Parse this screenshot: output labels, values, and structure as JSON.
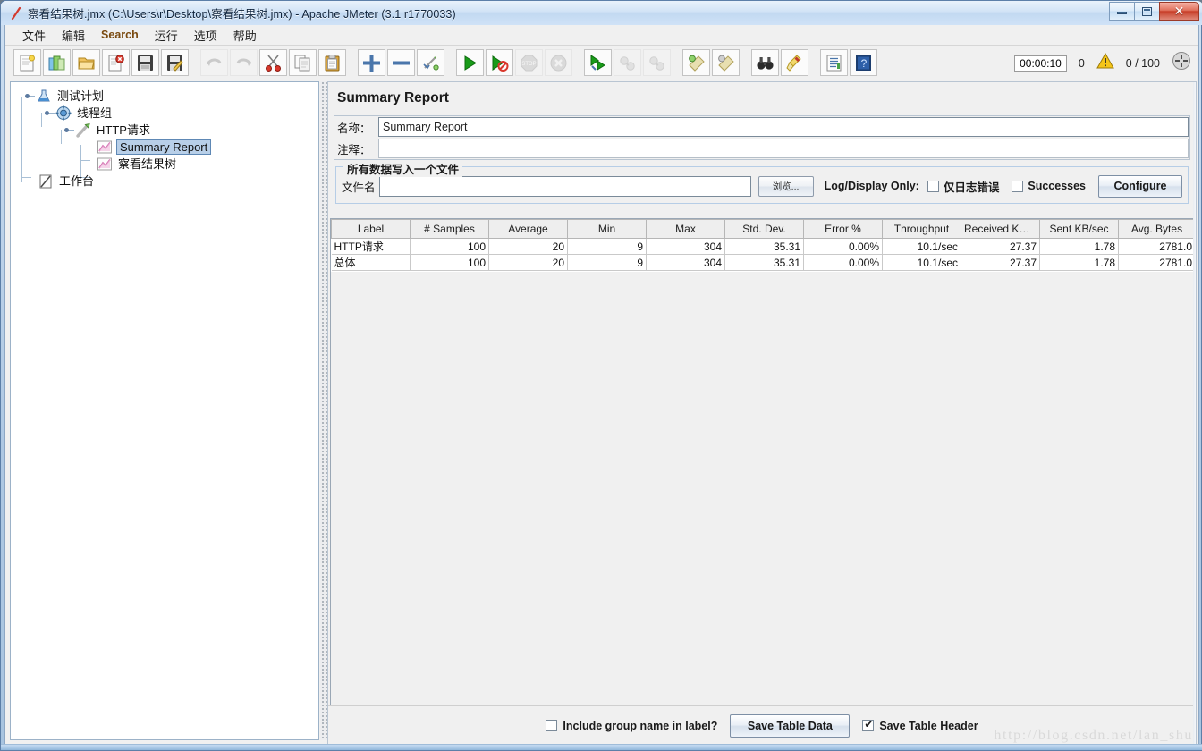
{
  "window": {
    "title": "察看结果树.jmx (C:\\Users\\r\\Desktop\\察看结果树.jmx) - Apache JMeter (3.1 r1770033)",
    "icon": "jmeter-feather-icon",
    "buttons": {
      "minimize": "–",
      "maximize": "□",
      "close": "✕"
    }
  },
  "menubar": {
    "items": [
      {
        "label": "文件",
        "lang": "zh"
      },
      {
        "label": "编辑",
        "lang": "zh"
      },
      {
        "label": "Search",
        "lang": "en"
      },
      {
        "label": "运行",
        "lang": "zh"
      },
      {
        "label": "选项",
        "lang": "zh"
      },
      {
        "label": "帮助",
        "lang": "zh"
      }
    ]
  },
  "toolbar": {
    "groups": [
      {
        "buttons": [
          {
            "icon": "new-document-icon",
            "disabled": false
          },
          {
            "icon": "templates-icon",
            "disabled": false
          },
          {
            "icon": "open-folder-icon",
            "disabled": false
          },
          {
            "icon": "close-document-icon",
            "disabled": false
          },
          {
            "icon": "save-floppy-icon",
            "disabled": false
          },
          {
            "icon": "save-as-icon",
            "disabled": false
          }
        ]
      },
      {
        "buttons": [
          {
            "icon": "undo-arrow-icon",
            "disabled": true
          },
          {
            "icon": "redo-arrow-icon",
            "disabled": true
          },
          {
            "icon": "cut-scissors-icon",
            "disabled": false
          },
          {
            "icon": "copy-pages-icon",
            "disabled": false
          },
          {
            "icon": "paste-clipboard-icon",
            "disabled": false
          }
        ]
      },
      {
        "buttons": [
          {
            "icon": "expand-plus-icon",
            "disabled": false
          },
          {
            "icon": "collapse-minus-icon",
            "disabled": false
          },
          {
            "icon": "toggle-enabled-icon",
            "disabled": false
          }
        ]
      },
      {
        "buttons": [
          {
            "icon": "start-play-icon",
            "disabled": false
          },
          {
            "icon": "start-no-timers-icon",
            "disabled": false
          },
          {
            "icon": "stop-sign-icon",
            "disabled": true
          },
          {
            "icon": "shutdown-x-icon",
            "disabled": true
          }
        ]
      },
      {
        "buttons": [
          {
            "icon": "remote-start-all-icon",
            "disabled": false
          },
          {
            "icon": "remote-stop-all-icon",
            "disabled": true
          },
          {
            "icon": "remote-shutdown-all-icon",
            "disabled": true
          }
        ]
      },
      {
        "buttons": [
          {
            "icon": "clear-broom-icon",
            "disabled": false
          },
          {
            "icon": "clear-all-broom-icon",
            "disabled": false
          }
        ]
      },
      {
        "buttons": [
          {
            "icon": "search-binoculars-icon",
            "disabled": false
          },
          {
            "icon": "reset-search-brush-icon",
            "disabled": false
          }
        ]
      },
      {
        "buttons": [
          {
            "icon": "function-helper-icon",
            "disabled": false
          },
          {
            "icon": "help-book-icon",
            "disabled": false
          }
        ]
      }
    ],
    "status": {
      "elapsed_time": "00:00:10",
      "warning_count": "0",
      "warning_icon": "warning-triangle-icon",
      "thread_counter": "0 / 100",
      "expand_icon": "expand-arrows-icon"
    }
  },
  "tree": {
    "nodes": [
      {
        "label": "测试计划",
        "depth": 0,
        "icon": "test-plan-icon",
        "selected": false,
        "expander": true
      },
      {
        "label": "线程组",
        "depth": 1,
        "icon": "thread-group-icon",
        "selected": false,
        "expander": true
      },
      {
        "label": "HTTP请求",
        "depth": 2,
        "icon": "http-sampler-icon",
        "selected": false,
        "expander": true
      },
      {
        "label": "Summary Report",
        "depth": 3,
        "icon": "listener-chart-icon",
        "selected": true,
        "expander": false
      },
      {
        "label": "察看结果树",
        "depth": 3,
        "icon": "listener-chart-icon",
        "selected": false,
        "expander": false
      },
      {
        "label": "工作台",
        "depth": 0,
        "icon": "workbench-icon",
        "selected": false,
        "expander": false
      }
    ]
  },
  "main": {
    "title": "Summary Report",
    "name_label": "名称：",
    "name_value": "Summary Report",
    "comment_label": "注释：",
    "comment_value": "",
    "file_group": {
      "legend": "所有数据写入一个文件",
      "filename_label": "文件名",
      "filename_value": "",
      "filename_placeholder": "",
      "browse_button": "浏览...",
      "log_display_only_label": "Log/Display Only:",
      "errors_only_label": "仅日志错误",
      "errors_only_checked": false,
      "successes_label": "Successes",
      "successes_checked": false,
      "configure_button": "Configure"
    },
    "table": {
      "columns": [
        "Label",
        "# Samples",
        "Average",
        "Min",
        "Max",
        "Std. Dev.",
        "Error %",
        "Throughput",
        "Received KB/...",
        "Sent KB/sec",
        "Avg. Bytes"
      ],
      "rows": [
        [
          "HTTP请求",
          "100",
          "20",
          "9",
          "304",
          "35.31",
          "0.00%",
          "10.1/sec",
          "27.37",
          "1.78",
          "2781.0"
        ],
        [
          "总体",
          "100",
          "20",
          "9",
          "304",
          "35.31",
          "0.00%",
          "10.1/sec",
          "27.37",
          "1.78",
          "2781.0"
        ]
      ]
    },
    "footer": {
      "include_group_name_label": "Include group name in label?",
      "include_group_name_checked": false,
      "save_table_data_button": "Save Table Data",
      "save_table_header_label": "Save Table Header",
      "save_table_header_checked": true
    }
  },
  "watermark": "http://blog.csdn.net/lan_shu",
  "colors": {
    "titlebar_blue": "#cfe0f2",
    "selection_blue": "#b8cfe8",
    "close_red": "#c73e28",
    "menu_en_brown": "#7a4a10",
    "panel_gray": "#f0f0f0"
  }
}
